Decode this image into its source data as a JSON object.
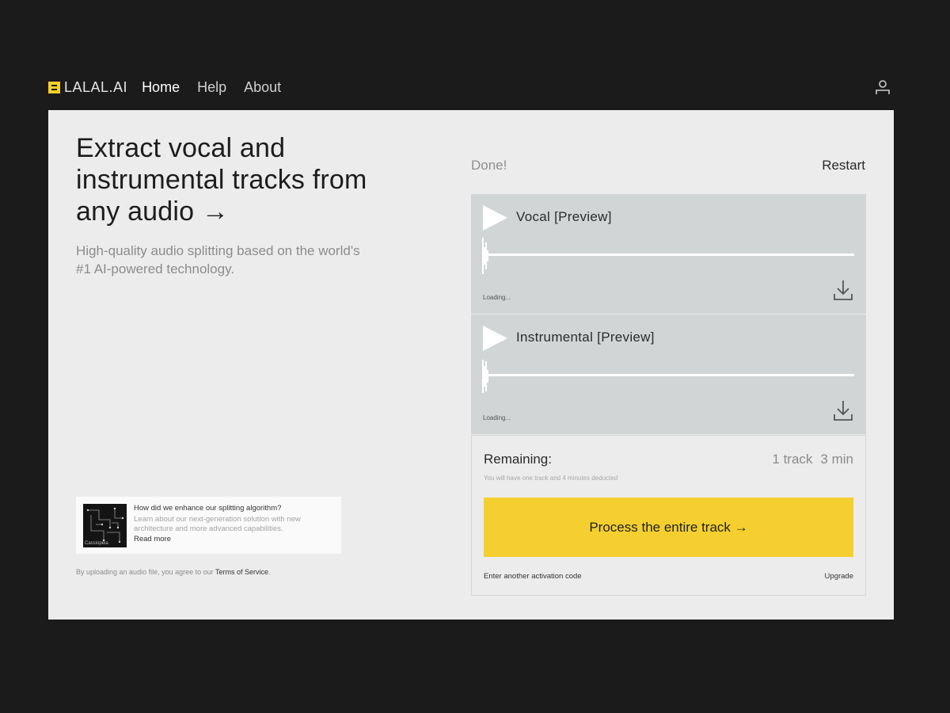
{
  "brand": {
    "name": "LALAL.AI"
  },
  "nav": {
    "items": [
      {
        "label": "Home",
        "active": true
      },
      {
        "label": "Help",
        "active": false
      },
      {
        "label": "About",
        "active": false
      }
    ]
  },
  "header": {
    "user_icon": "user-icon"
  },
  "hero": {
    "title": "Extract vocal and instrumental tracks from any audio →",
    "subtitle": "High-quality audio splitting based on the world's #1 AI-powered technology."
  },
  "news": {
    "thumb_label": "Cassiopeia",
    "title": "How did we enhance our splitting algorithm?",
    "description": "Learn about our next-generation solution with new architecture and more advanced capabilities.",
    "read_more": "Read more"
  },
  "tos": {
    "text": "By uploading an audio file, you agree to our ",
    "link": "Terms of Service",
    "suffix": "."
  },
  "status": {
    "done": "Done!",
    "restart": "Restart"
  },
  "tracks": [
    {
      "name": "Vocal [Preview]",
      "status": "Loading..."
    },
    {
      "name": "Instrumental [Preview]",
      "status": "Loading..."
    }
  ],
  "process": {
    "remaining_label": "Remaining:",
    "tracks_left": "1 track",
    "minutes_left": "3 min",
    "note": "You will have one track and 4 minutes deducted",
    "button": "Process the entire track →",
    "activation": "Enter another activation code",
    "upgrade": "Upgrade"
  },
  "colors": {
    "accent": "#f5cf2f",
    "background": "#1b1b1b",
    "panel": "#ececec",
    "track": "#d1d5d6"
  }
}
